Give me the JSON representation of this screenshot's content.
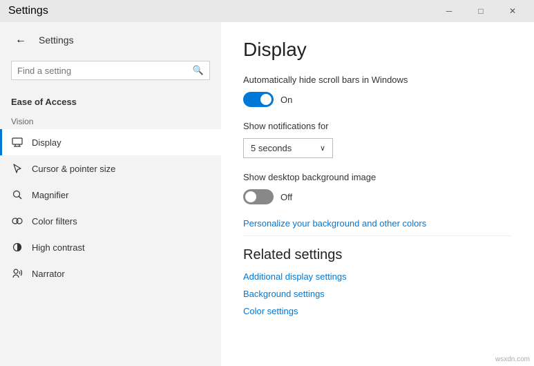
{
  "titlebar": {
    "title": "Settings",
    "minimize": "─",
    "maximize": "□",
    "close": "✕"
  },
  "sidebar": {
    "back_icon": "←",
    "app_title": "Settings",
    "search_placeholder": "Find a setting",
    "section_title": "Ease of Access",
    "vision_label": "Vision",
    "nav_items": [
      {
        "id": "display",
        "label": "Display",
        "icon": "display",
        "active": true
      },
      {
        "id": "cursor",
        "label": "Cursor & pointer size",
        "icon": "cursor",
        "active": false
      },
      {
        "id": "magnifier",
        "label": "Magnifier",
        "icon": "magnifier",
        "active": false
      },
      {
        "id": "color-filters",
        "label": "Color filters",
        "icon": "color",
        "active": false
      },
      {
        "id": "high-contrast",
        "label": "High contrast",
        "icon": "contrast",
        "active": false
      },
      {
        "id": "narrator",
        "label": "Narrator",
        "icon": "narrator",
        "active": false
      }
    ]
  },
  "content": {
    "page_title": "Display",
    "setting1_label": "Automatically hide scroll bars in Windows",
    "toggle1_state": "on",
    "toggle1_text": "On",
    "setting2_label": "Show notifications for",
    "dropdown_value": "5 seconds",
    "dropdown_chevron": "∨",
    "setting3_label": "Show desktop background image",
    "toggle2_state": "off",
    "toggle2_text": "Off",
    "personalize_link": "Personalize your background and other colors",
    "related_title": "Related settings",
    "related_links": [
      "Additional display settings",
      "Background settings",
      "Color settings"
    ]
  },
  "watermark": "wsxdn.com"
}
